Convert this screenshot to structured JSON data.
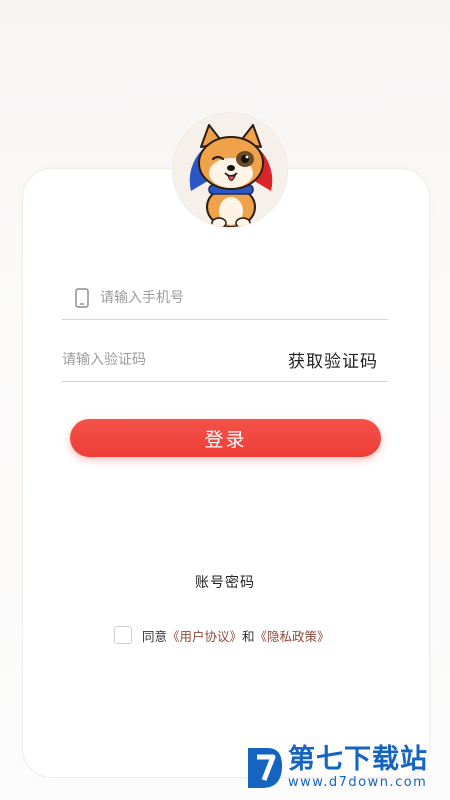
{
  "phone": {
    "placeholder": "请输入手机号"
  },
  "code": {
    "placeholder": "请输入验证码",
    "get_code_label": "获取验证码"
  },
  "login": {
    "label": "登录"
  },
  "account_password_label": "账号密码",
  "agreement": {
    "prefix": "同意",
    "user_agreement": "《用户协议》",
    "and": "和",
    "privacy_policy": "《隐私政策》",
    "checked": false
  },
  "watermark": {
    "name": "第七下载站",
    "url": "www.d7down.com"
  },
  "colors": {
    "accent": "#ef433c",
    "link": "#8d4a3e",
    "watermark": "#1564c0"
  },
  "icons": {
    "avatar": "shiba-dog-icon",
    "phone": "phone-icon",
    "watermark_logo": "d7-logo-icon"
  }
}
